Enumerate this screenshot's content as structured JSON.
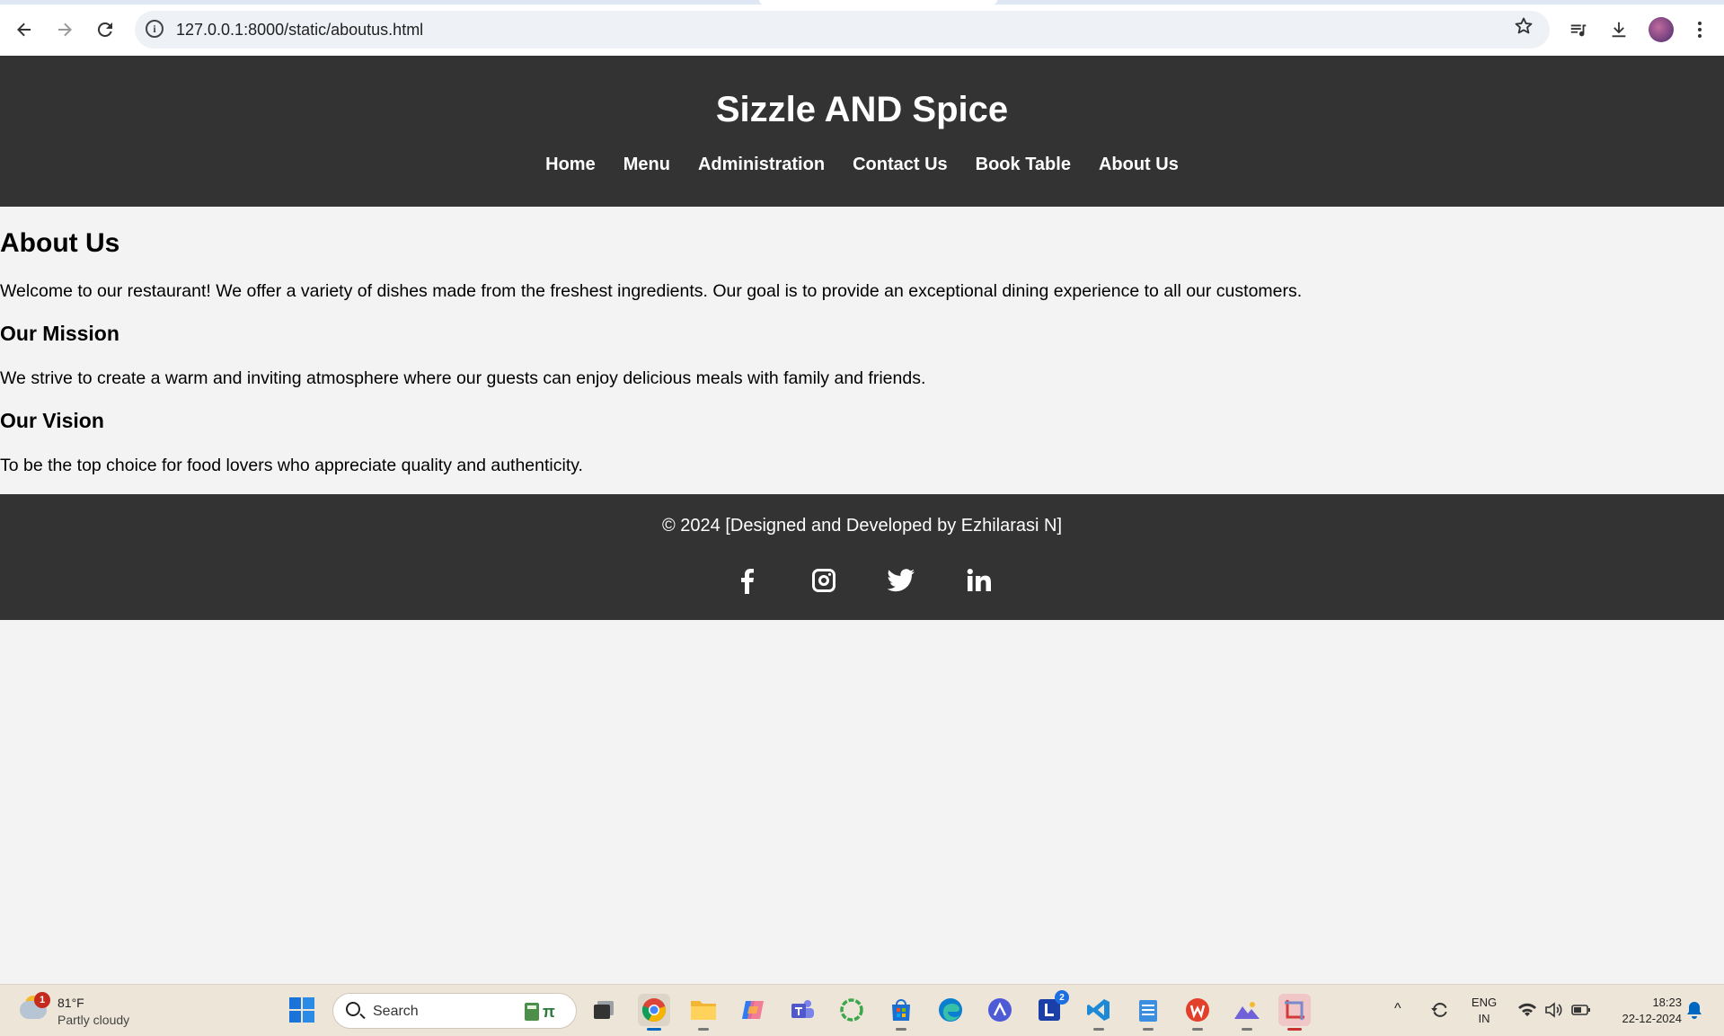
{
  "browser": {
    "url": "127.0.0.1:8000/static/aboutus.html",
    "icons": [
      "back-arrow-icon",
      "forward-arrow-icon",
      "reload-icon",
      "info-icon",
      "bookmark-star-icon",
      "media-icon",
      "download-icon",
      "profile-avatar",
      "menu-dots-icon"
    ]
  },
  "site": {
    "title": "Sizzle AND Spice",
    "nav": [
      "Home",
      "Menu",
      "Administration",
      "Contact Us",
      "Book Table",
      "About Us"
    ]
  },
  "content": {
    "heading": "About Us",
    "intro": "Welcome to our restaurant! We offer a variety of dishes made from the freshest ingredients. Our goal is to provide an exceptional dining experience to all our customers.",
    "mission_heading": "Our Mission",
    "mission_text": "We strive to create a warm and inviting atmosphere where our guests can enjoy delicious meals with family and friends.",
    "vision_heading": "Our Vision",
    "vision_text": "To be the top choice for food lovers who appreciate quality and authenticity."
  },
  "footer": {
    "copyright": "© 2024 [Designed and Developed by Ezhilarasi N]",
    "socials": [
      "facebook-icon",
      "instagram-icon",
      "twitter-icon",
      "linkedin-icon"
    ]
  },
  "taskbar": {
    "weather_badge": "1",
    "temperature": "81°F",
    "condition": "Partly cloudy",
    "search_placeholder": "Search",
    "calc_glyph": "π",
    "lang_top": "ENG",
    "lang_bottom": "IN",
    "time": "18:23",
    "date": "22-12-2024",
    "l_badge": "2",
    "tray_chevron": "^"
  },
  "colors": {
    "header_bg": "#333333",
    "page_bg": "#f3f3f3",
    "taskbar_bg": "#ece5d8"
  }
}
